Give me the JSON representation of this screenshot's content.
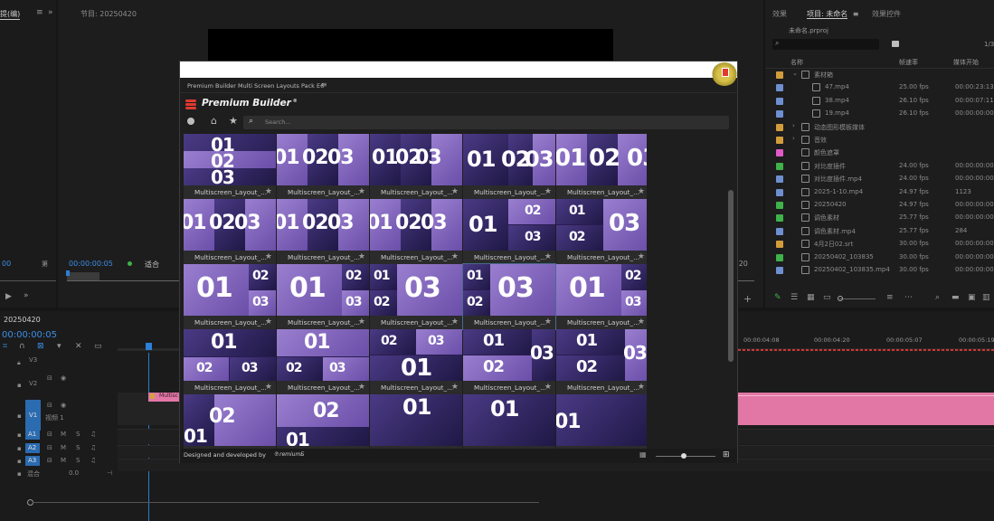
{
  "top_left": {
    "source_tab": "提(编)",
    "program_tab": "节目: 20250420",
    "timecode_left": "00",
    "timecode_mid": "00:00:00:05",
    "fit_label": "适合",
    "side_tc": ":20"
  },
  "right_panel": {
    "tabs": [
      "效果",
      "项目: 未命名",
      "效果控件"
    ],
    "project_file": "未命名.prproj",
    "search_placeholder": "",
    "columns": [
      "名称",
      "帧速率",
      "媒体开始"
    ],
    "count": "1/3",
    "rows": [
      {
        "name": "素材箱",
        "fps": "",
        "tc": "",
        "color": "#d39c3b",
        "indent": 1,
        "icon": "folder-icon"
      },
      {
        "name": "47.mp4",
        "fps": "25.00 fps",
        "tc": "00:00:23:13",
        "color": "#6e8fd0",
        "indent": 2,
        "icon": "video-file-icon"
      },
      {
        "name": "38.mp4",
        "fps": "26.10 fps",
        "tc": "00:00:07:11",
        "color": "#6e8fd0",
        "indent": 2,
        "icon": "video-file-icon"
      },
      {
        "name": "19.mp4",
        "fps": "26.10 fps",
        "tc": "00:00:00:00",
        "color": "#6e8fd0",
        "indent": 2,
        "icon": "video-file-icon"
      },
      {
        "name": "动态图形模板媒体",
        "fps": "",
        "tc": "",
        "color": "#d39c3b",
        "indent": 1,
        "icon": "folder-icon"
      },
      {
        "name": "音效",
        "fps": "",
        "tc": "",
        "color": "#d39c3b",
        "indent": 1,
        "icon": "folder-icon"
      },
      {
        "name": "颜色遮罩",
        "fps": "",
        "tc": "",
        "color": "#e05bc7",
        "indent": 0,
        "icon": "matte-icon"
      },
      {
        "name": "对比度插件",
        "fps": "24.00 fps",
        "tc": "00:00:00:00",
        "color": "#3fb24a",
        "indent": 0,
        "icon": "sequence-icon"
      },
      {
        "name": "对比度插件.mp4",
        "fps": "24.00 fps",
        "tc": "00:00:00:00",
        "color": "#6e8fd0",
        "indent": 0,
        "icon": "video-file-icon"
      },
      {
        "name": "2025-1-10.mp4",
        "fps": "24.97 fps",
        "tc": "1123",
        "color": "#6e8fd0",
        "indent": 0,
        "icon": "video-file-icon"
      },
      {
        "name": "20250420",
        "fps": "24.97 fps",
        "tc": "00:00:00:00",
        "color": "#3fb24a",
        "indent": 0,
        "icon": "sequence-icon"
      },
      {
        "name": "调色素材",
        "fps": "25.77 fps",
        "tc": "00:00:00:00",
        "color": "#3fb24a",
        "indent": 0,
        "icon": "sequence-icon"
      },
      {
        "name": "调色素材.mp4",
        "fps": "25.77 fps",
        "tc": "284",
        "color": "#6e8fd0",
        "indent": 0,
        "icon": "video-file-icon"
      },
      {
        "name": "4月2日02.srt",
        "fps": "30.00 fps",
        "tc": "00:00:00:00",
        "color": "#d39c3b",
        "indent": 0,
        "icon": "caption-icon"
      },
      {
        "name": "20250402_103835",
        "fps": "30.00 fps",
        "tc": "00:00:00:00",
        "color": "#3fb24a",
        "indent": 0,
        "icon": "sequence-icon"
      },
      {
        "name": "20250402_103835.mp4",
        "fps": "30.00 fps",
        "tc": "00:00:00:00",
        "color": "#6e8fd0",
        "indent": 0,
        "icon": "video-file-icon"
      }
    ]
  },
  "timeline": {
    "sequence_tab": "20250420",
    "timecode": "00:00:00:05",
    "ruler_marks": [
      "00:00:04:08",
      "00:00:04:20",
      "00:00:05:07",
      "00:00:05:19"
    ],
    "clip_label": "Multisc",
    "video_tracks": [
      "V3",
      "V2",
      "V1"
    ],
    "v1_name": "视频 1",
    "audio_tracks": [
      "A1",
      "A2",
      "A3"
    ],
    "mix_label": "混合",
    "mix_value": "0.0",
    "accent": "#2b7fd6",
    "clip_color": "#e277a6"
  },
  "plugin": {
    "panel_title": "Premium Builder Multi Screen Layouts Pack E6",
    "brand": "Premium Builder",
    "brand_mark": "®",
    "search_placeholder": "Search...",
    "tile_caption": "Multiscreen_Layout_...",
    "footer": "Designed and developed by",
    "footer_logo": "℗remiumБ",
    "accent": "#e03a2f"
  }
}
